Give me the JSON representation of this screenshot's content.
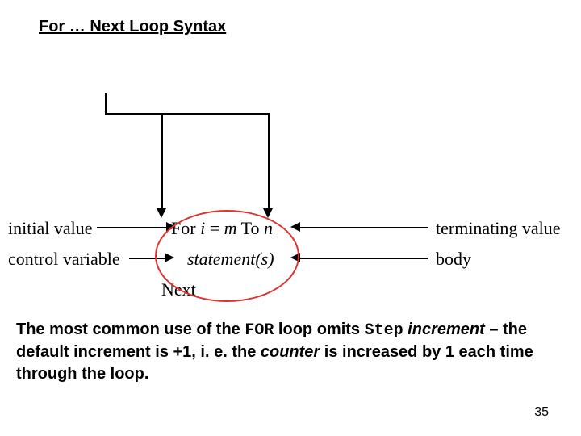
{
  "title": "For … Next Loop Syntax",
  "labels": {
    "initial": "initial value",
    "control": "control variable",
    "terminating": "terminating value",
    "body": "body"
  },
  "code": {
    "for_prefix": "For ",
    "for_i": "i",
    "for_eq": " = ",
    "for_m": "m",
    "for_to": " To ",
    "for_n": "n",
    "stmt": "statement(s)",
    "next": "Next"
  },
  "footer": {
    "t1": "The most common use of the ",
    "for_kw": "FOR",
    "t2": " loop",
    "t3": " omits ",
    "step_kw": "Step",
    "t4": " ",
    "incr": "increment",
    "t5": " – the default increment is +1, i. e. the ",
    "counter": "counter",
    "t6": " is increased by 1 each time through the loop."
  },
  "page": "35"
}
